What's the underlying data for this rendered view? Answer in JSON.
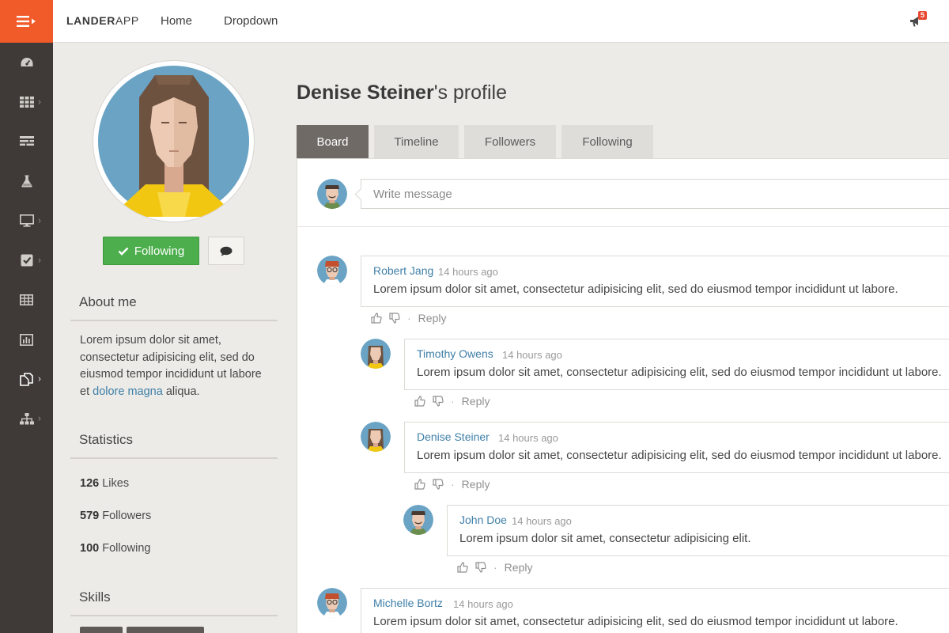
{
  "app": {
    "logo_bold": "LANDER",
    "logo_light": "APP"
  },
  "nav": {
    "home": "Home",
    "dropdown": "Dropdown"
  },
  "notifications": {
    "count": "5"
  },
  "profile": {
    "name": "Denise Steiner",
    "title_suffix": "'s profile",
    "following_label": "Following"
  },
  "tabs": [
    {
      "label": "Board"
    },
    {
      "label": "Timeline"
    },
    {
      "label": "Followers"
    },
    {
      "label": "Following"
    }
  ],
  "about": {
    "title": "About me",
    "text_before": "Lorem ipsum dolor sit amet, consectetur adipisicing elit, sed do eiusmod tempor incididunt ut labore et ",
    "link": "dolore magna",
    "text_after": " aliqua."
  },
  "statistics": {
    "title": "Statistics",
    "items": [
      {
        "value": "126",
        "label": " Likes"
      },
      {
        "value": "579",
        "label": " Followers"
      },
      {
        "value": "100",
        "label": " Following"
      }
    ]
  },
  "skills": {
    "title": "Skills"
  },
  "composer": {
    "placeholder": "Write message"
  },
  "comments": [
    {
      "author": "Robert Jang",
      "time": "14 hours ago",
      "text": "Lorem ipsum dolor sit amet, consectetur adipisicing elit, sed do eiusmod tempor incididunt ut labore.",
      "reply": "Reply"
    },
    {
      "author": "Timothy Owens",
      "time": "14 hours ago",
      "text": "Lorem ipsum dolor sit amet, consectetur adipisicing elit, sed do eiusmod tempor incididunt ut labore.",
      "reply": "Reply"
    },
    {
      "author": "Denise Steiner",
      "time": "14 hours ago",
      "text": "Lorem ipsum dolor sit amet, consectetur adipisicing elit, sed do eiusmod tempor incididunt ut labore.",
      "reply": "Reply"
    },
    {
      "author": "John Doe",
      "time": "14 hours ago",
      "text": "Lorem ipsum dolor sit amet, consectetur adipisicing elit.",
      "reply": "Reply"
    },
    {
      "author": "Michelle Bortz",
      "time": "14 hours ago",
      "text": "Lorem ipsum dolor sit amet, consectetur adipisicing elit, sed do eiusmod tempor incididunt ut labore."
    }
  ],
  "sidebar_icons": [
    "dashboard-icon",
    "grid-icon",
    "layout-icon",
    "flask-icon",
    "monitor-icon",
    "checkbox-icon",
    "table-icon",
    "bar-chart-icon",
    "copy-icon",
    "sitemap-icon"
  ],
  "colors": {
    "accent": "#f15a29",
    "rail": "#3f3a37",
    "success": "#4cae4c",
    "link": "#3f7fa8",
    "active_tab": "#706a67"
  }
}
